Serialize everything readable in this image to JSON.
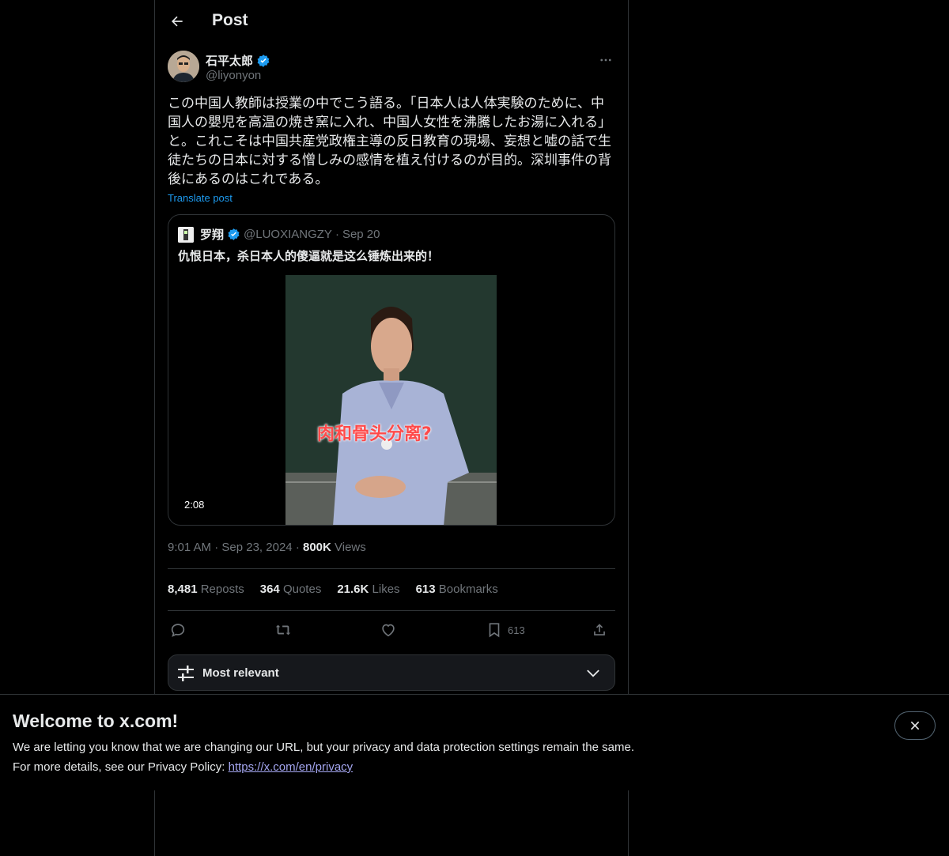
{
  "header": {
    "title": "Post"
  },
  "author": {
    "name": "石平太郎",
    "handle": "@liyonyon"
  },
  "post": {
    "text": "この中国人教師は授業の中でこう語る。「日本人は人体実験のために、中国人の嬰児を高温の焼き窯に入れ、中国人女性を沸騰したお湯に入れる」と。これこそは中国共産党政権主導の反日教育の現場、妄想と嘘の話で生徒たちの日本に対する憎しみの感情を植え付けるのが目的。深圳事件の背後にあるのはこれである。",
    "translate_label": "Translate post"
  },
  "quote": {
    "name": "罗翔",
    "handle": "@LUOXIANGZY",
    "separator": "·",
    "date": "Sep 20",
    "text": "仇恨日本，杀日本人的傻逼就是这么锤炼出来的！",
    "video_caption": "肉和骨头分离?",
    "duration": "2:08"
  },
  "meta": {
    "time": "9:01 AM",
    "dot1": "·",
    "date": "Sep 23, 2024",
    "dot2": "·",
    "views_count": "800K",
    "views_label": "Views"
  },
  "stats": {
    "reposts_count": "8,481",
    "reposts_label": "Reposts",
    "quotes_count": "364",
    "quotes_label": "Quotes",
    "likes_count": "21.6K",
    "likes_label": "Likes",
    "bookmarks_count": "613",
    "bookmarks_label": "Bookmarks"
  },
  "actions": {
    "bookmark_count": "613"
  },
  "sort": {
    "label": "Most relevant"
  },
  "banner": {
    "title": "Welcome to x.com!",
    "line1": "We are letting you know that we are changing our URL, but your privacy and data protection settings remain the same.",
    "line2_prefix": "For more details, see our Privacy Policy:",
    "link": "https://x.com/en/privacy"
  },
  "colors": {
    "accent": "#1d9bf0",
    "muted": "#71767b",
    "text": "#e7e9ea",
    "border": "#2f3336",
    "link": "#a4a6f0"
  }
}
